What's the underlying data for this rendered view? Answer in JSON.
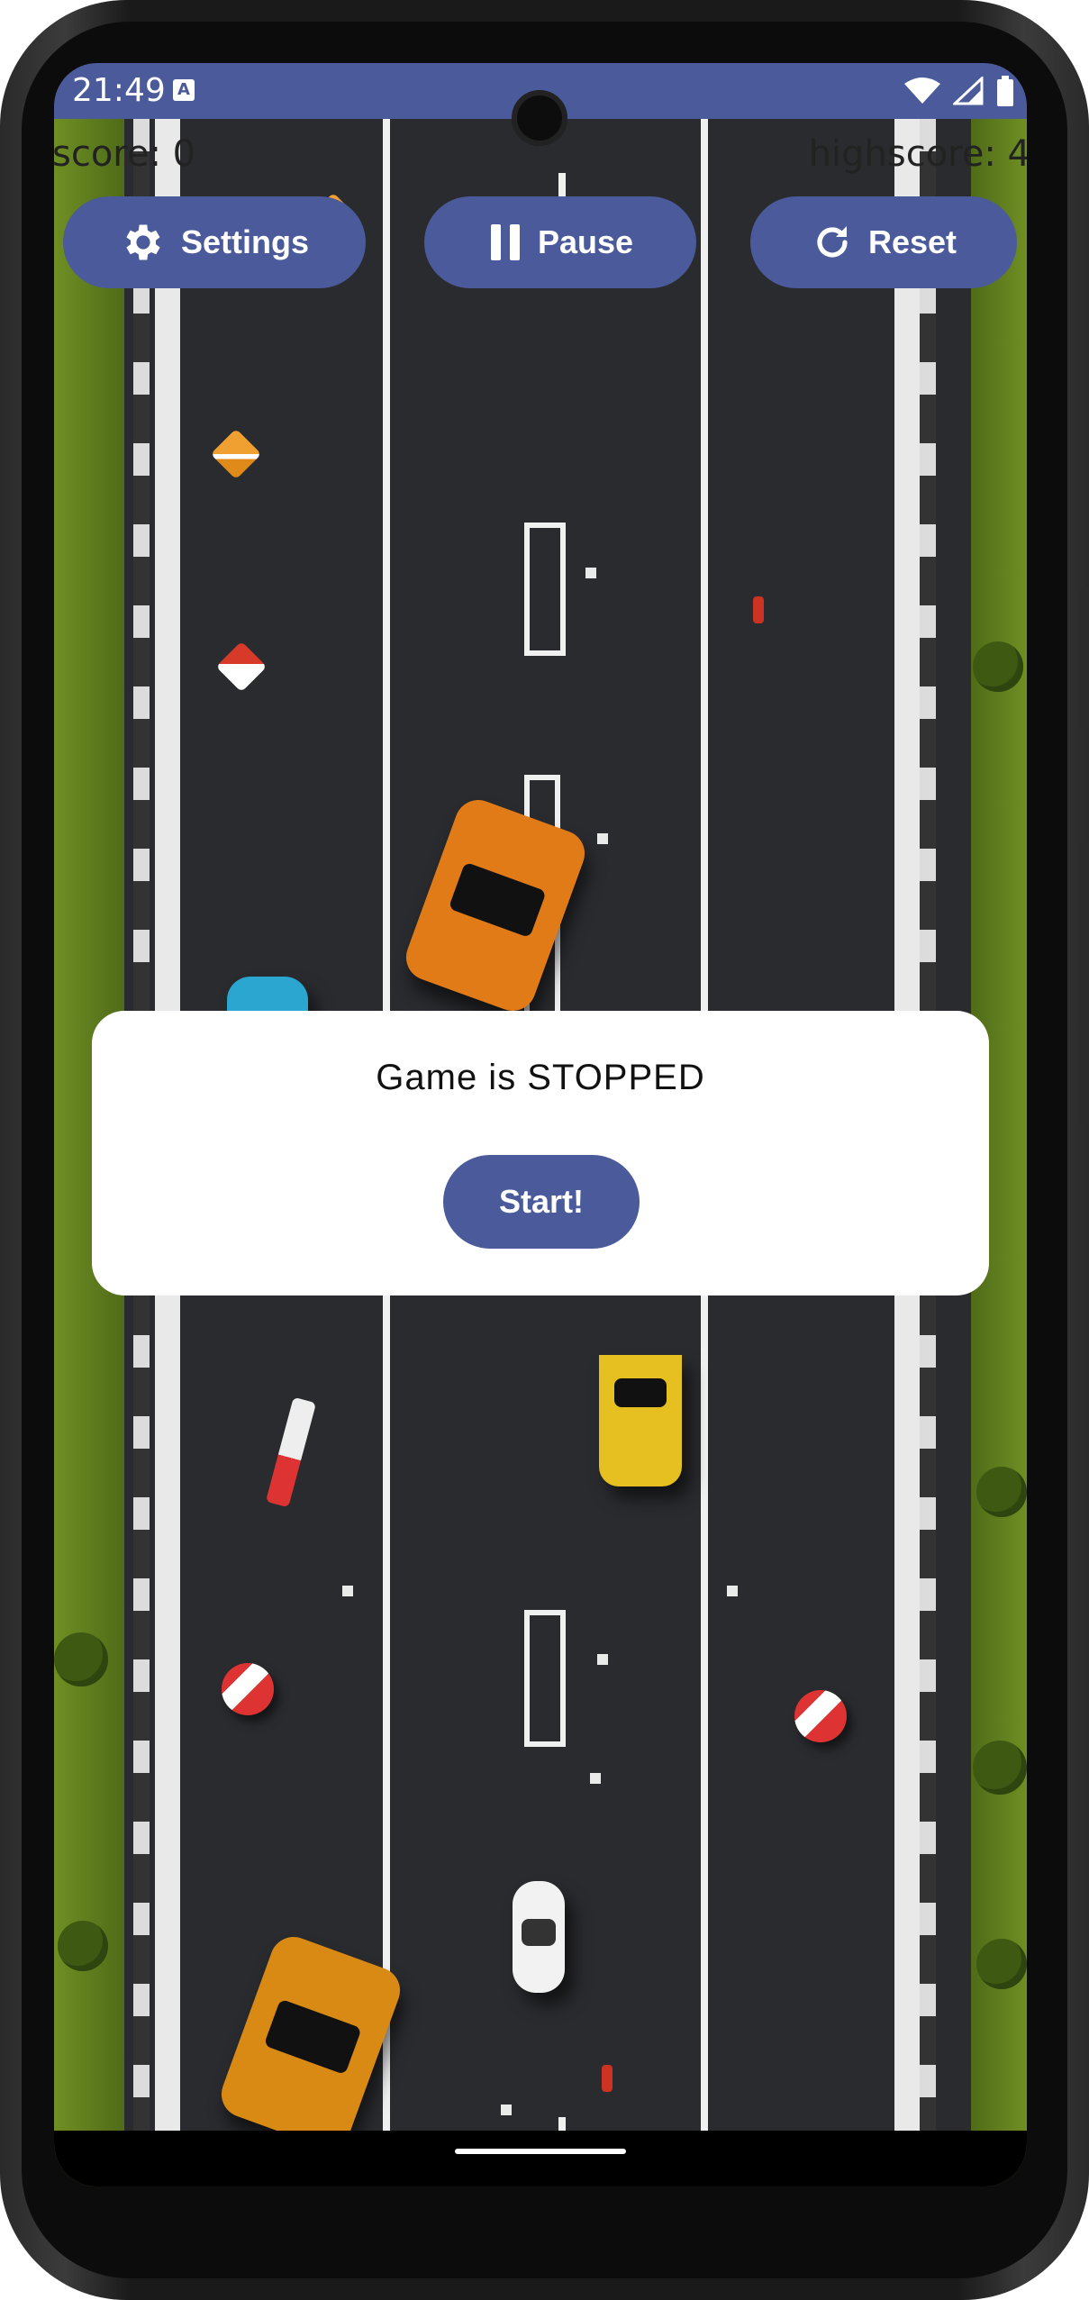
{
  "status_bar": {
    "time": "21:49",
    "notification_icon_label": "A",
    "icons": [
      "wifi-icon",
      "signal-icon",
      "battery-icon"
    ]
  },
  "game": {
    "score_label": "score: 0",
    "highscore_label": "highscore: 4"
  },
  "toolbar": {
    "settings_label": "Settings",
    "pause_label": "Pause",
    "reset_label": "Reset"
  },
  "dialog": {
    "message": "Game is STOPPED",
    "start_label": "Start!"
  },
  "colors": {
    "accent": "#4a5a9a",
    "road": "#2a2b2f",
    "grass": "#5a7a1e"
  }
}
